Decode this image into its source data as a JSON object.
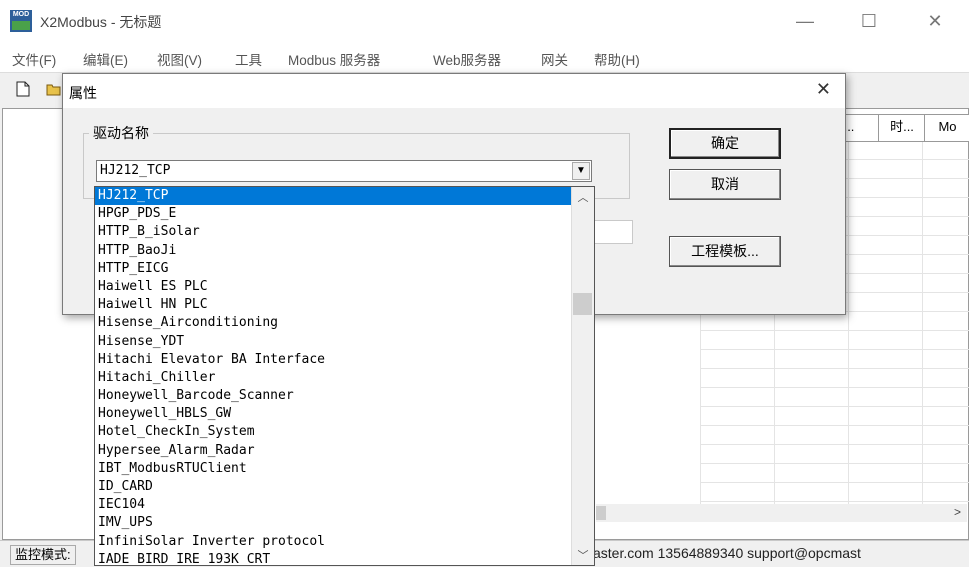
{
  "app": {
    "icon_text": "MOD",
    "title": "X2Modbus - 无标题",
    "window_controls": {
      "minimize": "—",
      "maximize": "☐",
      "close": "✕"
    }
  },
  "menu": [
    "文件(F)",
    "编辑(E)",
    "视图(V)",
    "工具",
    "Modbus 服务器",
    "Web服务器",
    "网关",
    "帮助(H)"
  ],
  "grid": {
    "headers": [
      "...",
      "时...",
      "Mo"
    ]
  },
  "dialog": {
    "title": "属性",
    "close": "✕",
    "group_label": "驱动名称",
    "driver_value": "HJ212_TCP",
    "ok_button": "确定",
    "cancel_button": "取消",
    "template_button": "工程模板..."
  },
  "dropdown": {
    "items": [
      "HJ212_TCP",
      "HPGP_PDS_E",
      "HTTP_B_iSolar",
      "HTTP_BaoJi",
      "HTTP_EICG",
      "Haiwell ES PLC",
      "Haiwell HN PLC",
      "Hisense_Airconditioning",
      "Hisense_YDT",
      "Hitachi Elevator BA Interface",
      "Hitachi_Chiller",
      "Honeywell_Barcode_Scanner",
      "Honeywell_HBLS_GW",
      "Hotel_CheckIn_System",
      "Hypersee_Alarm_Radar",
      "IBT_ModbusRTUClient",
      "ID_CARD",
      "IEC104",
      "IMV_UPS",
      "InfiniSolar Inverter protocol",
      "IADE BIRD IRE 193K CRT"
    ],
    "selected_index": 0
  },
  "statusbar": {
    "mode_label": "监控模式:",
    "contact": "aster.com 13564889340 support@opcmast"
  },
  "colors": {
    "selection": "#0078d7",
    "workspace": "#ffffff",
    "chrome": "#f0f0f0"
  }
}
